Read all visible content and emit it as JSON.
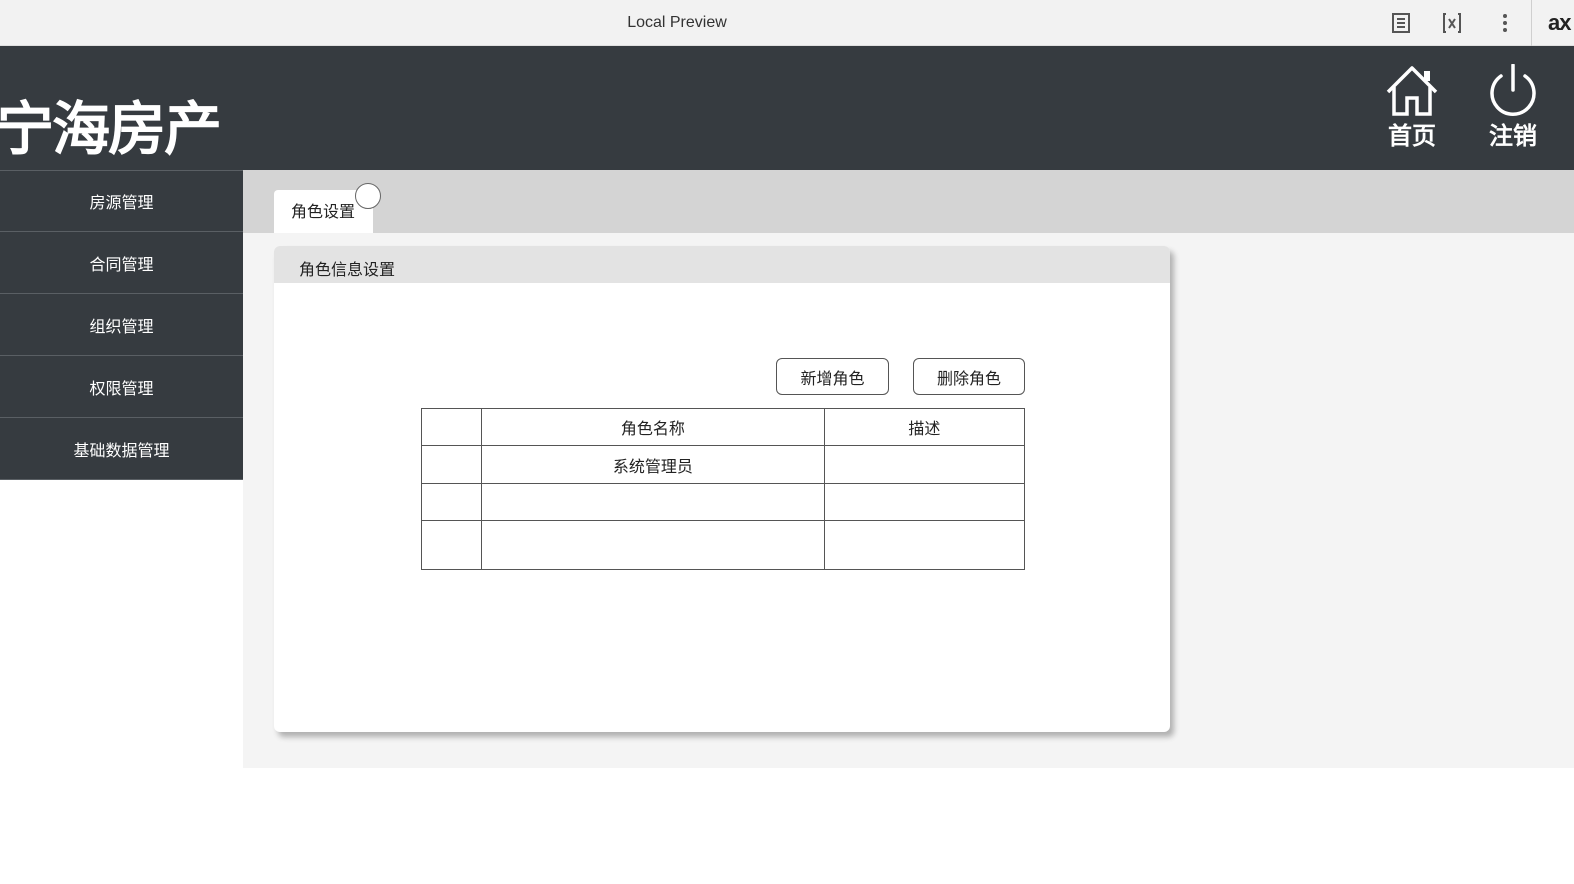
{
  "browser": {
    "title": "Local Preview",
    "icons": [
      "notes-icon",
      "variables-icon",
      "more-vertical-icon"
    ],
    "extension_label": "ax"
  },
  "header": {
    "logo": "宁海房产",
    "home_label": "首页",
    "logout_label": "注销",
    "background": "#363b40"
  },
  "sidebar": {
    "items": [
      {
        "label": "房源管理"
      },
      {
        "label": "合同管理"
      },
      {
        "label": "组织管理"
      },
      {
        "label": "权限管理"
      },
      {
        "label": "基础数据管理"
      }
    ]
  },
  "tabs": [
    {
      "label": "角色设置",
      "active": true
    }
  ],
  "panel": {
    "title": "角色信息设置",
    "add_button": "新增角色",
    "delete_button": "删除角色",
    "table": {
      "columns": [
        "",
        "角色名称",
        "描述"
      ],
      "rows": [
        [
          "",
          "系统管理员",
          ""
        ],
        [
          "",
          "",
          ""
        ],
        [
          "",
          "",
          ""
        ]
      ]
    }
  }
}
